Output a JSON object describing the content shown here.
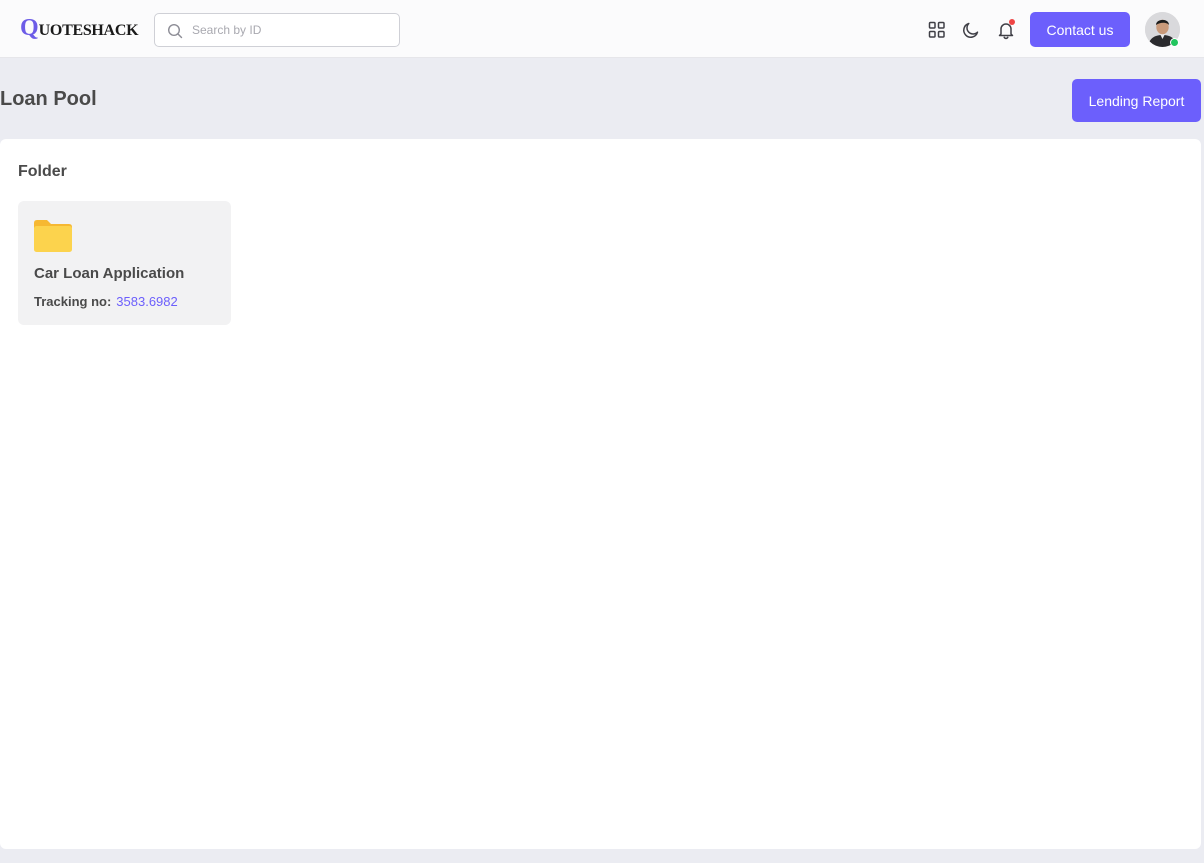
{
  "header": {
    "logo_first": "Q",
    "logo_rest": "UOTESHACK",
    "search_placeholder": "Search by ID",
    "contact_label": "Contact us",
    "icons": [
      "grid-icon",
      "moon-icon",
      "bell-icon"
    ]
  },
  "page": {
    "title": "Loan Pool",
    "lending_report_label": "Lending Report"
  },
  "panel": {
    "title": "Folder",
    "folders": [
      {
        "name": "Car Loan Application",
        "tracking_label": "Tracking no:",
        "tracking_value": "3583.6982"
      }
    ]
  },
  "colors": {
    "accent": "#6c5ffc",
    "background": "#ebecf2",
    "card": "#f2f2f3",
    "folder": "#fcd34d",
    "notification": "#ef4444",
    "online": "#22c55e"
  }
}
